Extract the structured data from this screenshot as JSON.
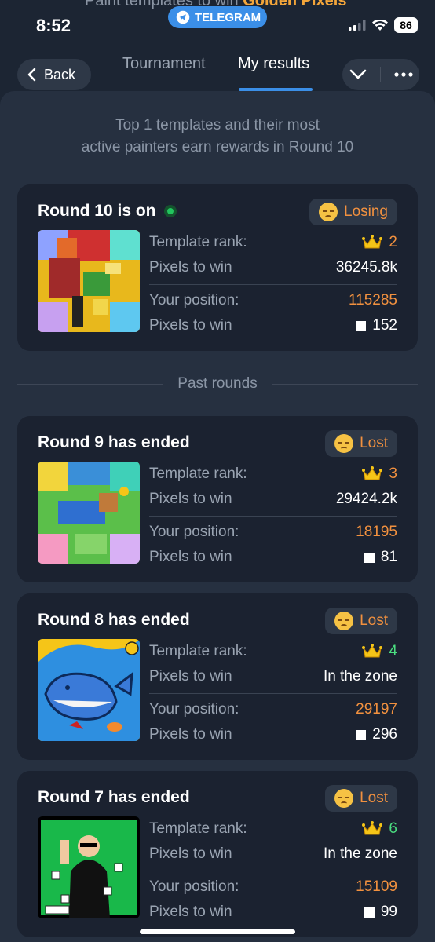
{
  "status_bar": {
    "time": "8:52",
    "battery": "86",
    "peek_text_prefix": "Paint templates to win ",
    "peek_text_highlight": "Golden Pixels",
    "telegram_label": "TELEGRAM"
  },
  "header": {
    "back_label": "Back",
    "tabs": [
      {
        "label": "Tournament",
        "active": false
      },
      {
        "label": "My results",
        "active": true
      }
    ]
  },
  "intro": {
    "line1": "Top 1 templates and their most",
    "line2": "active painters earn rewards in Round 10"
  },
  "current_round": {
    "title": "Round 10 is on",
    "status": "Losing",
    "template_rank_label": "Template rank:",
    "template_rank": "2",
    "pixels_to_win_label": "Pixels to win",
    "template_pixels_to_win": "36245.8k",
    "your_position_label": "Your position:",
    "your_position": "115285",
    "your_pixels_to_win": "152"
  },
  "past_rounds_label": "Past rounds",
  "past_rounds": [
    {
      "title": "Round 9 has ended",
      "status": "Lost",
      "template_rank_label": "Template rank:",
      "template_rank": "3",
      "pixels_to_win_label": "Pixels to win",
      "template_pixels_to_win": "29424.2k",
      "your_position_label": "Your position:",
      "your_position": "18195",
      "your_pixels_to_win": "81"
    },
    {
      "title": "Round 8 has ended",
      "status": "Lost",
      "template_rank_label": "Template rank:",
      "template_rank": "4",
      "pixels_to_win_label": "Pixels to win",
      "template_pixels_to_win": "In the zone",
      "your_position_label": "Your position:",
      "your_position": "29197",
      "your_pixels_to_win": "296"
    },
    {
      "title": "Round 7 has ended",
      "status": "Lost",
      "template_rank_label": "Template rank:",
      "template_rank": "6",
      "pixels_to_win_label": "Pixels to win",
      "template_pixels_to_win": "In the zone",
      "your_position_label": "Your position:",
      "your_position": "15109",
      "your_pixels_to_win": "99"
    }
  ],
  "colors": {
    "background": "#1c2533",
    "panel": "#263040",
    "card": "#1b2230",
    "accent_blue": "#3b8fe8",
    "orange": "#f2913f",
    "green": "#4ade80"
  }
}
